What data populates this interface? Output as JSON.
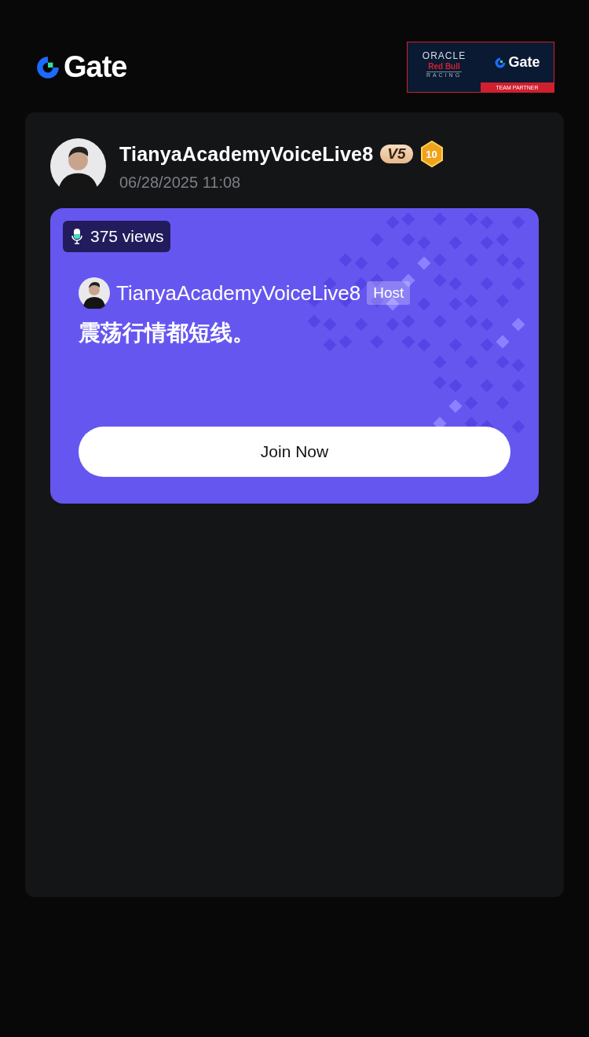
{
  "header": {
    "logo_text": "Gate",
    "partner": {
      "line_1": "ORACLE",
      "line_2": "Red Bull",
      "line_3": "RACING",
      "brand": "Gate",
      "ribbon": "TEAM PARTNER"
    }
  },
  "post": {
    "author": "TianyaAcademyVoiceLive8",
    "vip": "V5",
    "level_badge": "10",
    "date": "06/28/2025 11:08",
    "live": {
      "views": "375 views",
      "host_name": "TianyaAcademyVoiceLive8",
      "host_tag": "Host",
      "title": "震荡行情都短线。",
      "button": "Join Now"
    }
  }
}
